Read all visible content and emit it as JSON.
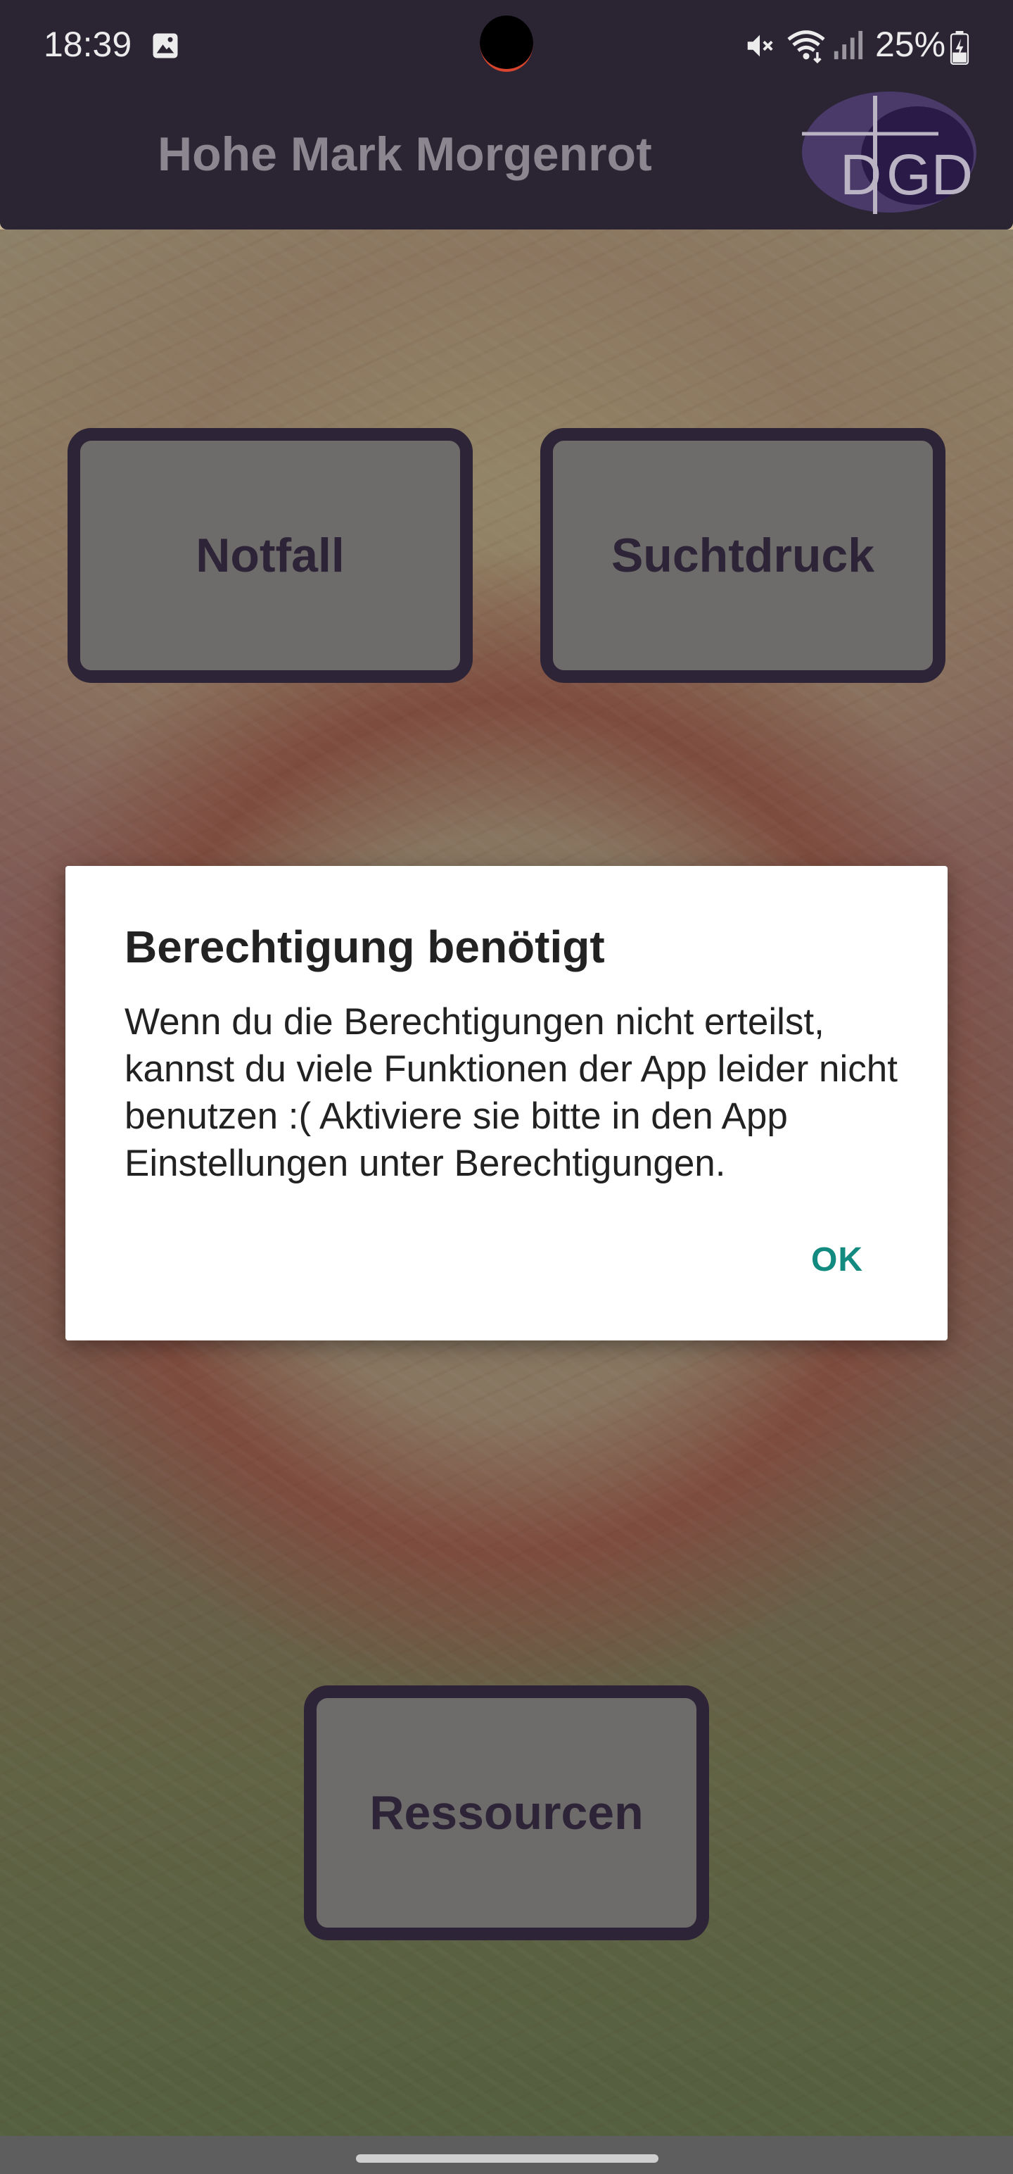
{
  "status_bar": {
    "time": "18:39",
    "battery_percent": "25%",
    "icons": [
      "image-notification-icon",
      "mute-icon",
      "wifi-icon",
      "signal-icon",
      "battery-charging-icon"
    ]
  },
  "app_bar": {
    "title": "Hohe Mark Morgenrot",
    "logo_text": "DGD"
  },
  "buttons": {
    "notfall": "Notfall",
    "suchtdruck": "Suchtdruck",
    "ressourcen": "Ressourcen"
  },
  "dialog": {
    "title": "Berechtigung benötigt",
    "message": "Wenn du die Berechtigungen nicht erteilst, kannst du viele Funktionen der App leider nicht benutzen :( Aktiviere sie bitte in den App Einstellungen unter Berechtigungen.",
    "ok_label": "OK"
  },
  "colors": {
    "app_bar": "#2a2433",
    "button_border": "#2d2537",
    "button_fill": "#6e6b6b",
    "dialog_accent": "#128a80"
  }
}
